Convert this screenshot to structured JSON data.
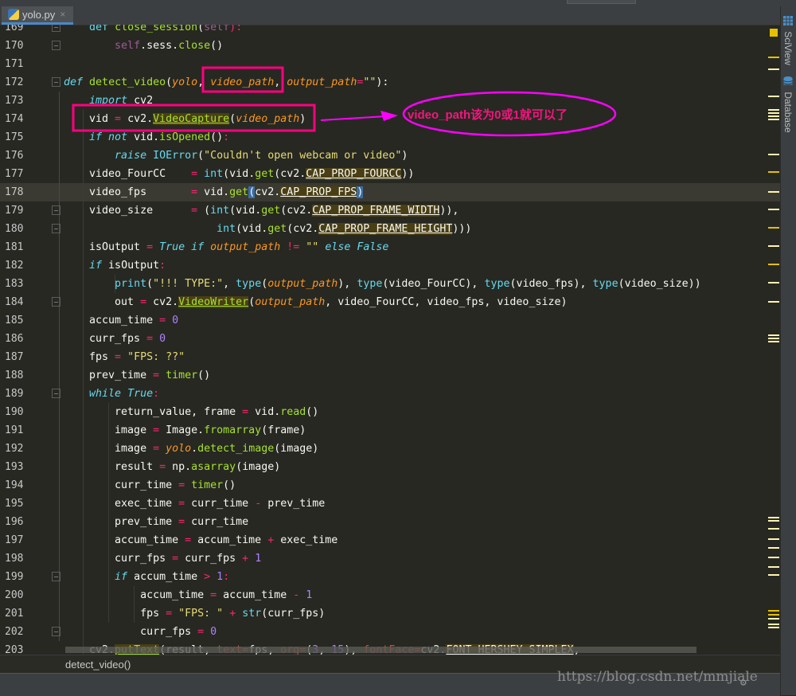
{
  "tab": {
    "title": "yolo.py",
    "icon": "python-file-icon",
    "close": "×"
  },
  "right_tools": [
    {
      "label": "SciView",
      "icon": "grid-icon"
    },
    {
      "label": "Database",
      "icon": "database-icon"
    }
  ],
  "editor": {
    "current_line": 178,
    "lines": [
      {
        "n": "169",
        "tokens": [
          [
            "t",
            "    "
          ],
          [
            "kwn",
            "def"
          ],
          [
            "t",
            " "
          ],
          [
            "fn",
            "close_session"
          ],
          [
            "t",
            "("
          ],
          [
            "self",
            "self"
          ],
          [
            "op",
            "):"
          ]
        ]
      },
      {
        "n": "170",
        "tokens": [
          [
            "t",
            "        "
          ],
          [
            "self",
            "self"
          ],
          [
            "t",
            ".sess."
          ],
          [
            "fn",
            "close"
          ],
          [
            "t",
            "()"
          ]
        ]
      },
      {
        "n": "171",
        "tokens": []
      },
      {
        "n": "172",
        "tokens": [
          [
            "kw",
            "def"
          ],
          [
            "t",
            " "
          ],
          [
            "fn",
            "detect_video"
          ],
          [
            "t",
            "("
          ],
          [
            "par",
            "yolo"
          ],
          [
            "t",
            ", "
          ],
          [
            "par",
            "video_path"
          ],
          [
            "t",
            ", "
          ],
          [
            "par",
            "output_path"
          ],
          [
            "op",
            "="
          ],
          [
            "str",
            "\"\""
          ],
          [
            "t",
            "):"
          ]
        ]
      },
      {
        "n": "173",
        "tokens": [
          [
            "t",
            "    "
          ],
          [
            "kw",
            "import"
          ],
          [
            "t",
            " cv2"
          ]
        ]
      },
      {
        "n": "174",
        "tokens": [
          [
            "t",
            "    vid "
          ],
          [
            "op",
            "="
          ],
          [
            "t",
            " cv2."
          ],
          [
            "fnhl",
            "VideoCapture"
          ],
          [
            "t",
            "("
          ],
          [
            "par",
            "video_path"
          ],
          [
            "t",
            ")"
          ]
        ]
      },
      {
        "n": "175",
        "tokens": [
          [
            "t",
            "    "
          ],
          [
            "kw",
            "if not"
          ],
          [
            "t",
            " vid."
          ],
          [
            "fn",
            "isOpened"
          ],
          [
            "t",
            "()"
          ],
          [
            "op",
            ":"
          ]
        ]
      },
      {
        "n": "176",
        "tokens": [
          [
            "t",
            "        "
          ],
          [
            "kw",
            "raise"
          ],
          [
            "t",
            " "
          ],
          [
            "kwn",
            "IOError"
          ],
          [
            "t",
            "("
          ],
          [
            "str",
            "\"Couldn't open webcam or video\""
          ],
          [
            "t",
            ")"
          ]
        ]
      },
      {
        "n": "177",
        "tokens": [
          [
            "t",
            "    video_FourCC    "
          ],
          [
            "op",
            "="
          ],
          [
            "t",
            " "
          ],
          [
            "kwn",
            "int"
          ],
          [
            "t",
            "(vid."
          ],
          [
            "fn",
            "get"
          ],
          [
            "t",
            "(cv2."
          ],
          [
            "hl",
            "CAP_PROP_FOURCC"
          ],
          [
            "t",
            "))"
          ]
        ]
      },
      {
        "n": "178",
        "tokens": [
          [
            "t",
            "    video_fps       "
          ],
          [
            "op",
            "="
          ],
          [
            "t",
            " vid."
          ],
          [
            "fn",
            "get"
          ],
          [
            "br",
            "("
          ],
          [
            "t",
            "cv2."
          ],
          [
            "hl",
            "CAP_PROP_FPS"
          ],
          [
            "br",
            ")"
          ]
        ]
      },
      {
        "n": "179",
        "tokens": [
          [
            "t",
            "    video_size      "
          ],
          [
            "op",
            "="
          ],
          [
            "t",
            " ("
          ],
          [
            "kwn",
            "int"
          ],
          [
            "t",
            "(vid."
          ],
          [
            "fn",
            "get"
          ],
          [
            "t",
            "(cv2."
          ],
          [
            "hl",
            "CAP_PROP_FRAME_WIDTH"
          ],
          [
            "t",
            ")),"
          ]
        ]
      },
      {
        "n": "180",
        "tokens": [
          [
            "t",
            "                        "
          ],
          [
            "kwn",
            "int"
          ],
          [
            "t",
            "(vid."
          ],
          [
            "fn",
            "get"
          ],
          [
            "t",
            "(cv2."
          ],
          [
            "hl",
            "CAP_PROP_FRAME_HEIGHT"
          ],
          [
            "t",
            ")))"
          ]
        ]
      },
      {
        "n": "181",
        "tokens": [
          [
            "t",
            "    isOutput "
          ],
          [
            "op",
            "="
          ],
          [
            "t",
            " "
          ],
          [
            "kw",
            "True if"
          ],
          [
            "t",
            " "
          ],
          [
            "par",
            "output_path"
          ],
          [
            "t",
            " "
          ],
          [
            "op",
            "!="
          ],
          [
            "t",
            " "
          ],
          [
            "str",
            "\"\""
          ],
          [
            "t",
            " "
          ],
          [
            "kw",
            "else False"
          ]
        ]
      },
      {
        "n": "182",
        "tokens": [
          [
            "t",
            "    "
          ],
          [
            "kw",
            "if"
          ],
          [
            "t",
            " isOutput"
          ],
          [
            "op",
            ":"
          ]
        ]
      },
      {
        "n": "183",
        "tokens": [
          [
            "t",
            "        "
          ],
          [
            "kwn",
            "print"
          ],
          [
            "t",
            "("
          ],
          [
            "str",
            "\"!!! TYPE:\""
          ],
          [
            "t",
            ", "
          ],
          [
            "kwn",
            "type"
          ],
          [
            "t",
            "("
          ],
          [
            "par",
            "output_path"
          ],
          [
            "t",
            "), "
          ],
          [
            "kwn",
            "type"
          ],
          [
            "t",
            "(video_FourCC), "
          ],
          [
            "kwn",
            "type"
          ],
          [
            "t",
            "(video_fps), "
          ],
          [
            "kwn",
            "type"
          ],
          [
            "t",
            "(video_size))"
          ]
        ]
      },
      {
        "n": "184",
        "tokens": [
          [
            "t",
            "        out "
          ],
          [
            "op",
            "="
          ],
          [
            "t",
            " cv2."
          ],
          [
            "fnhl",
            "VideoWriter"
          ],
          [
            "t",
            "("
          ],
          [
            "par",
            "output_path"
          ],
          [
            "t",
            ", video_FourCC, video_fps, video_size)"
          ]
        ]
      },
      {
        "n": "185",
        "tokens": [
          [
            "t",
            "    accum_time "
          ],
          [
            "op",
            "="
          ],
          [
            "t",
            " "
          ],
          [
            "num",
            "0"
          ]
        ]
      },
      {
        "n": "186",
        "tokens": [
          [
            "t",
            "    curr_fps "
          ],
          [
            "op",
            "="
          ],
          [
            "t",
            " "
          ],
          [
            "num",
            "0"
          ]
        ]
      },
      {
        "n": "187",
        "tokens": [
          [
            "t",
            "    fps "
          ],
          [
            "op",
            "="
          ],
          [
            "t",
            " "
          ],
          [
            "str",
            "\"FPS: ??\""
          ]
        ]
      },
      {
        "n": "188",
        "tokens": [
          [
            "t",
            "    prev_time "
          ],
          [
            "op",
            "="
          ],
          [
            "t",
            " "
          ],
          [
            "fn",
            "timer"
          ],
          [
            "t",
            "()"
          ]
        ]
      },
      {
        "n": "189",
        "tokens": [
          [
            "t",
            "    "
          ],
          [
            "kw",
            "while True"
          ],
          [
            "op",
            ":"
          ]
        ]
      },
      {
        "n": "190",
        "tokens": [
          [
            "t",
            "        return_value, frame "
          ],
          [
            "op",
            "="
          ],
          [
            "t",
            " vid."
          ],
          [
            "fn",
            "read"
          ],
          [
            "t",
            "()"
          ]
        ]
      },
      {
        "n": "191",
        "tokens": [
          [
            "t",
            "        image "
          ],
          [
            "op",
            "="
          ],
          [
            "t",
            " Image."
          ],
          [
            "fn",
            "fromarray"
          ],
          [
            "t",
            "(frame)"
          ]
        ]
      },
      {
        "n": "192",
        "tokens": [
          [
            "t",
            "        image "
          ],
          [
            "op",
            "="
          ],
          [
            "t",
            " "
          ],
          [
            "par",
            "yolo"
          ],
          [
            "t",
            "."
          ],
          [
            "fn",
            "detect_image"
          ],
          [
            "t",
            "(image)"
          ]
        ]
      },
      {
        "n": "193",
        "tokens": [
          [
            "t",
            "        result "
          ],
          [
            "op",
            "="
          ],
          [
            "t",
            " np."
          ],
          [
            "fn",
            "asarray"
          ],
          [
            "t",
            "(image)"
          ]
        ]
      },
      {
        "n": "194",
        "tokens": [
          [
            "t",
            "        curr_time "
          ],
          [
            "op",
            "="
          ],
          [
            "t",
            " "
          ],
          [
            "fn",
            "timer"
          ],
          [
            "t",
            "()"
          ]
        ]
      },
      {
        "n": "195",
        "tokens": [
          [
            "t",
            "        exec_time "
          ],
          [
            "op",
            "="
          ],
          [
            "t",
            " curr_time "
          ],
          [
            "op",
            "-"
          ],
          [
            "t",
            " prev_time"
          ]
        ]
      },
      {
        "n": "196",
        "tokens": [
          [
            "t",
            "        prev_time "
          ],
          [
            "op",
            "="
          ],
          [
            "t",
            " curr_time"
          ]
        ]
      },
      {
        "n": "197",
        "tokens": [
          [
            "t",
            "        accum_time "
          ],
          [
            "op",
            "="
          ],
          [
            "t",
            " accum_time "
          ],
          [
            "op",
            "+"
          ],
          [
            "t",
            " exec_time"
          ]
        ]
      },
      {
        "n": "198",
        "tokens": [
          [
            "t",
            "        curr_fps "
          ],
          [
            "op",
            "="
          ],
          [
            "t",
            " curr_fps "
          ],
          [
            "op",
            "+"
          ],
          [
            "t",
            " "
          ],
          [
            "num",
            "1"
          ]
        ]
      },
      {
        "n": "199",
        "tokens": [
          [
            "t",
            "        "
          ],
          [
            "kw",
            "if"
          ],
          [
            "t",
            " accum_time "
          ],
          [
            "op",
            ">"
          ],
          [
            "t",
            " "
          ],
          [
            "num",
            "1"
          ],
          [
            "op",
            ":"
          ]
        ]
      },
      {
        "n": "200",
        "tokens": [
          [
            "t",
            "            accum_time "
          ],
          [
            "op",
            "="
          ],
          [
            "t",
            " accum_time "
          ],
          [
            "op",
            "-"
          ],
          [
            "t",
            " "
          ],
          [
            "num",
            "1"
          ]
        ]
      },
      {
        "n": "201",
        "tokens": [
          [
            "t",
            "            fps "
          ],
          [
            "op",
            "="
          ],
          [
            "t",
            " "
          ],
          [
            "str",
            "\"FPS: \""
          ],
          [
            "t",
            " "
          ],
          [
            "op",
            "+"
          ],
          [
            "t",
            " "
          ],
          [
            "kwn",
            "str"
          ],
          [
            "t",
            "(curr_fps)"
          ]
        ]
      },
      {
        "n": "202",
        "tokens": [
          [
            "t",
            "            curr_fps "
          ],
          [
            "op",
            "="
          ],
          [
            "t",
            " "
          ],
          [
            "num",
            "0"
          ]
        ]
      },
      {
        "n": "203",
        "tokens": [
          [
            "t",
            "    cv2."
          ],
          [
            "fnhl",
            "putText"
          ],
          [
            "t",
            "(result, "
          ],
          [
            "kwarg",
            "text="
          ],
          [
            "t",
            "fps, "
          ],
          [
            "kwarg",
            "org="
          ],
          [
            "t",
            "("
          ],
          [
            "num",
            "3"
          ],
          [
            "t",
            ", "
          ],
          [
            "num",
            "15"
          ],
          [
            "t",
            "), "
          ],
          [
            "kwarg",
            "fontFace="
          ],
          [
            "t",
            "cv2."
          ],
          [
            "hl",
            "FONT_HERSHEY_SIMPLEX"
          ],
          [
            "t",
            ","
          ]
        ]
      }
    ]
  },
  "breadcrumb": "detect_video()",
  "annotation": {
    "text": "video_path该为0或1就可以了",
    "color": "#f5157e",
    "ellipse_color": "#ff00ff",
    "box_color": "#ff0080"
  },
  "watermark": "https://blog.csdn.net/mmjiale",
  "colors": {
    "background": "#272822",
    "keyword": "#66d9ef",
    "function": "#a6e22e",
    "string": "#e6db74",
    "parameter": "#fd971f",
    "operator": "#f92672",
    "number": "#ae81ff"
  }
}
